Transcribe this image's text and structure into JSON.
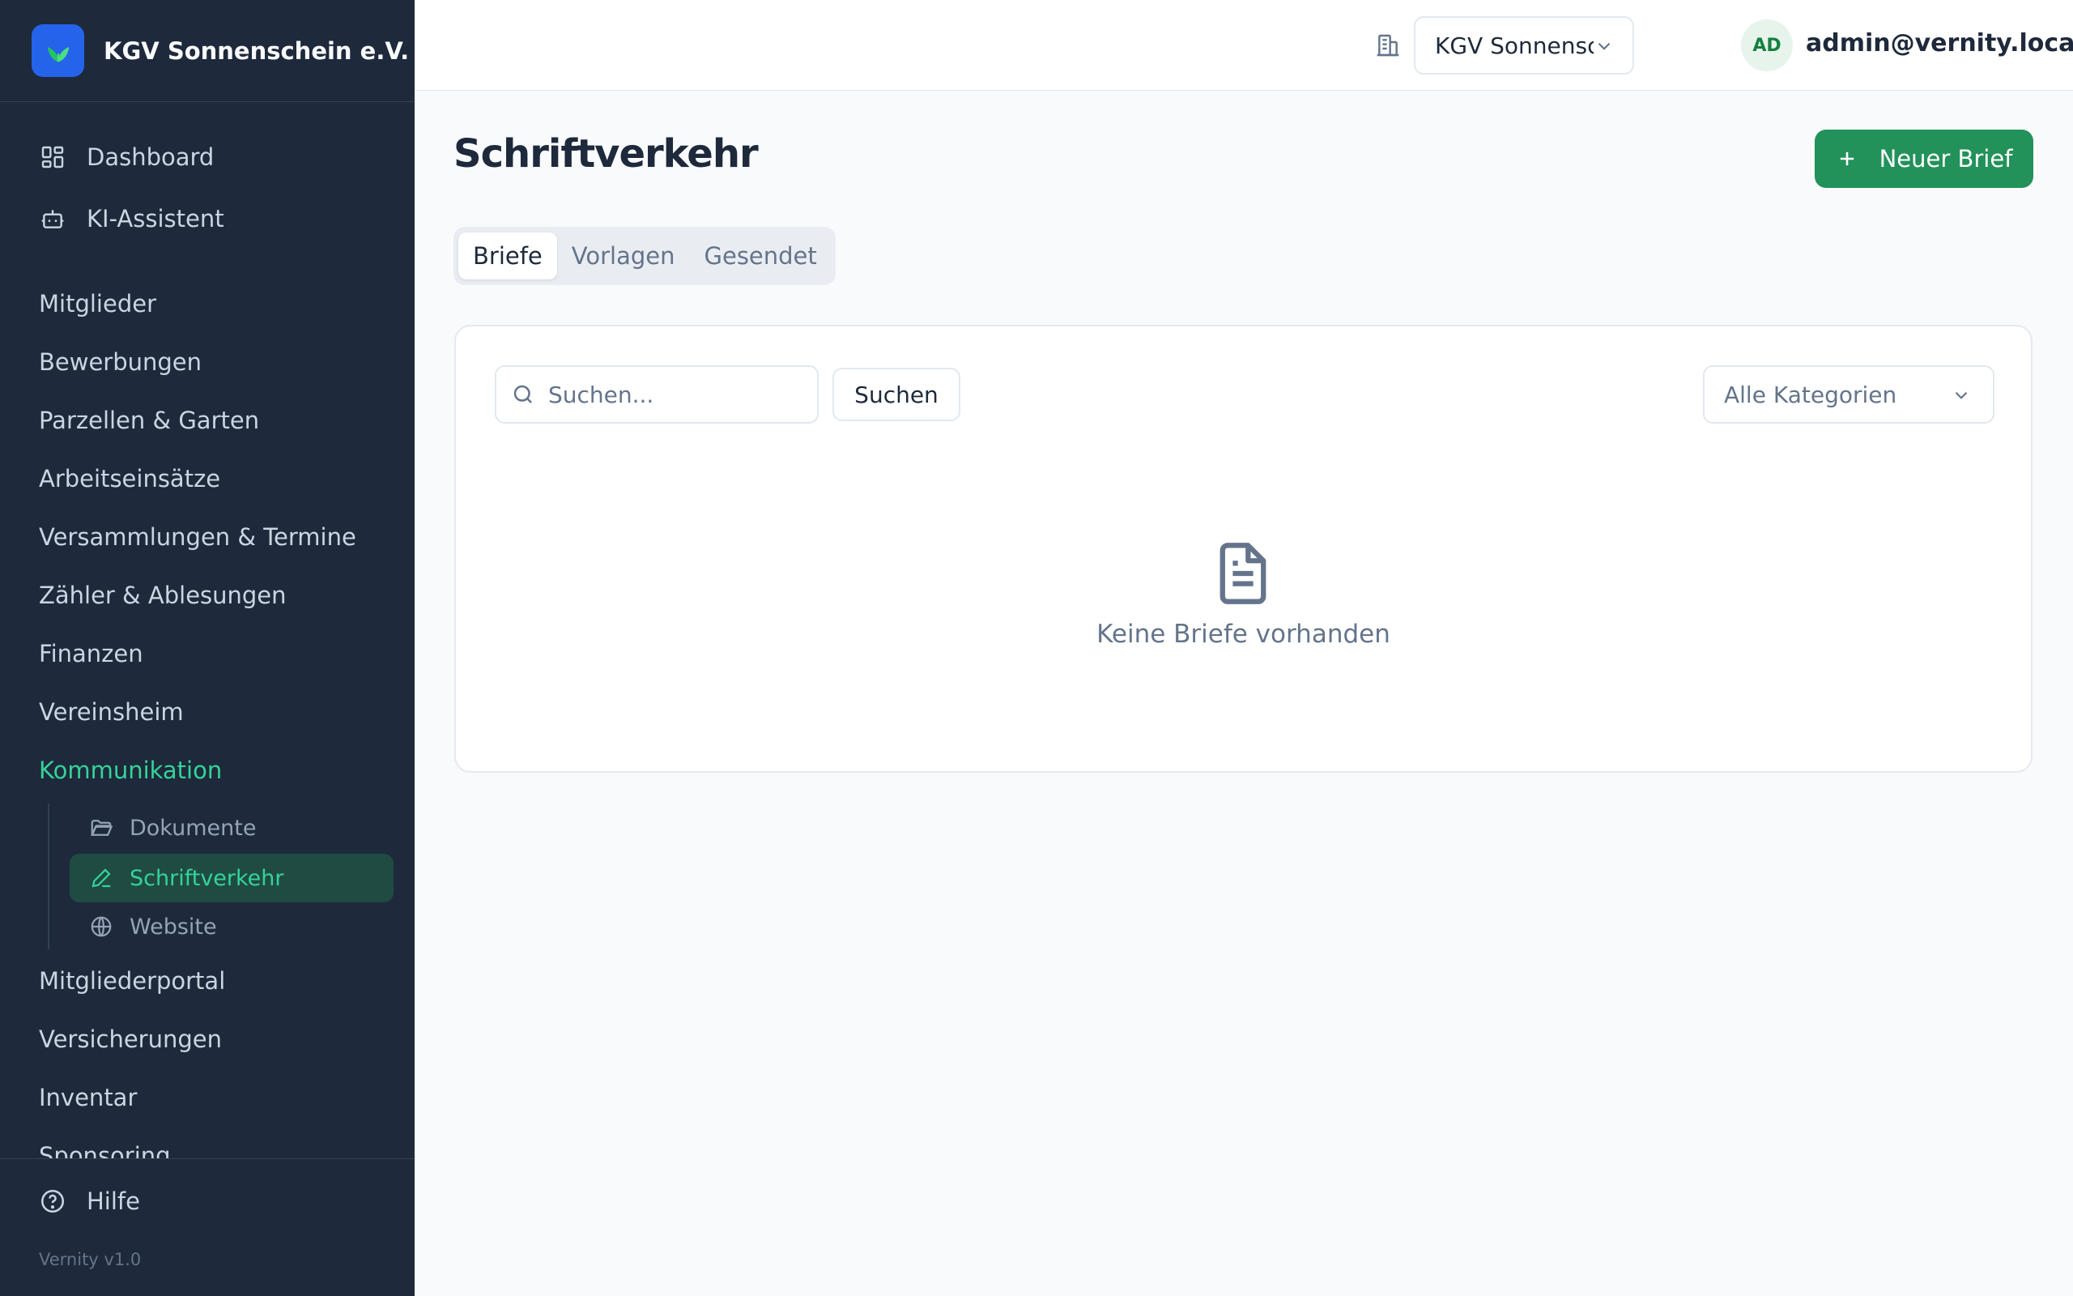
{
  "sidebar": {
    "brand_name": "KGV Sonnenschein e.V.",
    "top_items": [
      {
        "label": "Dashboard",
        "icon": "dashboard-icon"
      },
      {
        "label": "KI-Assistent",
        "icon": "robot-icon"
      }
    ],
    "sections": [
      {
        "label": "Mitglieder"
      },
      {
        "label": "Bewerbungen"
      },
      {
        "label": "Parzellen & Garten"
      },
      {
        "label": "Arbeitseinsätze"
      },
      {
        "label": "Versammlungen & Termine"
      },
      {
        "label": "Zähler & Ablesungen"
      },
      {
        "label": "Finanzen"
      },
      {
        "label": "Vereinsheim"
      },
      {
        "label": "Kommunikation",
        "expanded": true
      },
      {
        "label": "Mitgliederportal"
      },
      {
        "label": "Versicherungen"
      },
      {
        "label": "Inventar"
      },
      {
        "label": "Sponsoring"
      }
    ],
    "sub_items": [
      {
        "label": "Dokumente",
        "icon": "folder-icon"
      },
      {
        "label": "Schriftverkehr",
        "icon": "pen-icon",
        "active": true
      },
      {
        "label": "Website",
        "icon": "globe-icon"
      }
    ],
    "help_label": "Hilfe",
    "version": "Vernity v1.0"
  },
  "topbar": {
    "org_selected": "KGV Sonnenschein e.V.",
    "avatar_initials": "AD",
    "user_email": "admin@vernity.local"
  },
  "page": {
    "title": "Schriftverkehr",
    "new_button_label": "Neuer Brief",
    "tabs": [
      {
        "label": "Briefe",
        "active": true
      },
      {
        "label": "Vorlagen"
      },
      {
        "label": "Gesendet"
      }
    ],
    "search_placeholder": "Suchen...",
    "search_button_label": "Suchen",
    "category_selected": "Alle Kategorien",
    "empty_text": "Keine Briefe vorhanden"
  },
  "colors": {
    "sidebar_bg": "#1e293b",
    "accent_green": "#22925a",
    "active_text": "#34d399",
    "brand_logo_bg": "#2563eb"
  }
}
